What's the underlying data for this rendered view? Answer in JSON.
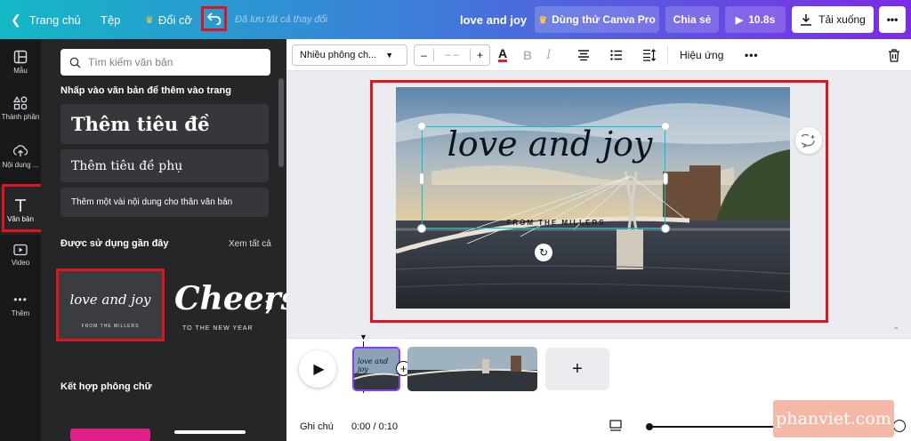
{
  "topbar": {
    "home": "Trang chủ",
    "file": "Tệp",
    "resize": "Đổi cỡ",
    "saved_status": "Đã lưu tất cả thay đổi",
    "doc_title": "love and joy",
    "try_pro": "Dùng thử Canva Pro",
    "share": "Chia sẻ",
    "duration": "10.8s",
    "download": "Tải xuống"
  },
  "rail": {
    "items": [
      {
        "label": "Mẫu",
        "icon": "layout-icon"
      },
      {
        "label": "Thành phần",
        "icon": "shapes-icon"
      },
      {
        "label": "Nội dung ...",
        "icon": "upload-icon"
      },
      {
        "label": "Văn bản",
        "icon": "text-icon"
      },
      {
        "label": "Video",
        "icon": "video-icon"
      },
      {
        "label": "Thêm",
        "icon": "more-icon"
      }
    ]
  },
  "panel": {
    "search_placeholder": "Tìm kiếm văn bản",
    "add_text_title": "Nhấp vào văn bản để thêm vào trang",
    "heading": "Thêm tiêu đề",
    "subheading": "Thêm tiêu đề phụ",
    "body": "Thêm một vài nội dung cho thân văn bản",
    "recent_title": "Được sử dụng gần đây",
    "see_all": "Xem tất cả",
    "recent_1_main": "love and joy",
    "recent_1_sub": "FROM THE MILLERS",
    "recent_2_main": "Cheers",
    "recent_2_sub": "TO THE NEW YEAR",
    "font_combo_title": "Kết hợp phông chữ"
  },
  "toolbar": {
    "font": "Nhiều phông ch...",
    "size": "– –",
    "effects": "Hiệu ứng"
  },
  "canvas": {
    "headline": "love and joy",
    "subline": "FROM THE MILLERS"
  },
  "timeline": {
    "clip_text": "love and joy",
    "notes": "Ghi chú",
    "time": "0:00 / 0:10"
  },
  "watermark": "phanviet.com",
  "colors": {
    "accent_red": "#e0141e",
    "selection": "#00c4cc",
    "rail_bg": "#18191b",
    "panel_bg": "#252627"
  }
}
